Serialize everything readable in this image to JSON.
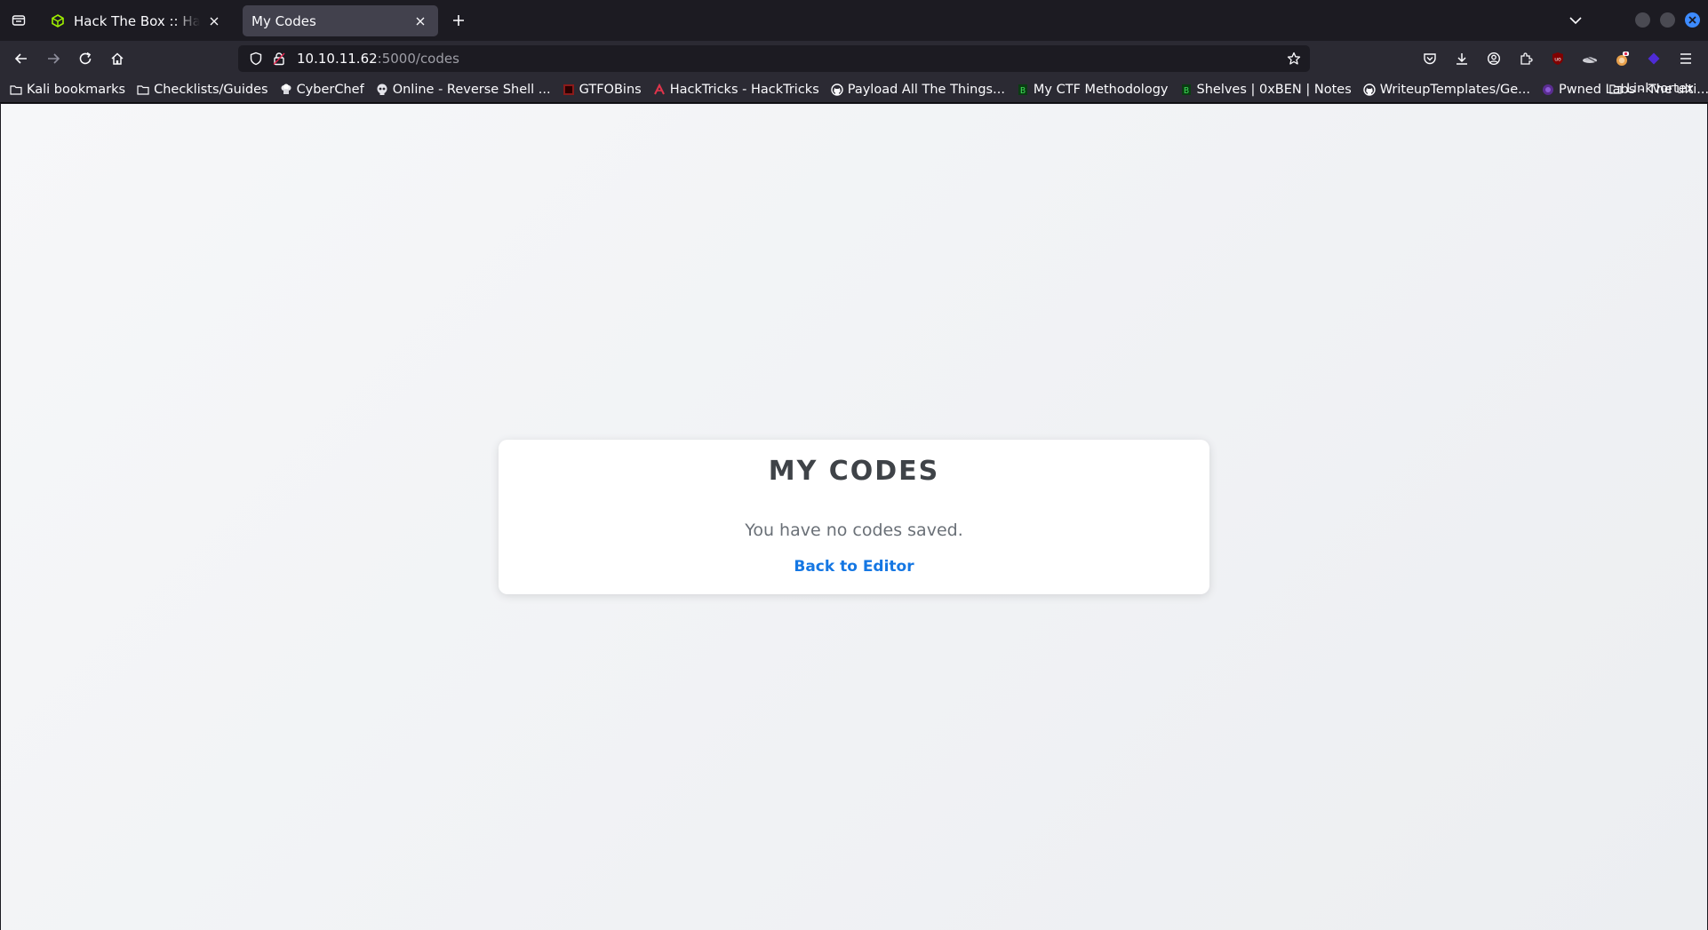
{
  "browser": {
    "tabs": [
      {
        "title": "Hack The Box :: Hack The Box",
        "favicon": "htb-cube-icon",
        "active": false
      },
      {
        "title": "My Codes",
        "favicon": "none",
        "active": true
      }
    ],
    "url": {
      "host": "10.10.11.62",
      "path": ":5000/codes"
    },
    "bookmarks": [
      {
        "label": "Kali bookmarks",
        "icon": "folder-icon"
      },
      {
        "label": "Checklists/Guides",
        "icon": "folder-icon"
      },
      {
        "label": "CyberChef",
        "icon": "chef-hat-icon"
      },
      {
        "label": "Online - Reverse Shell ...",
        "icon": "skull-icon"
      },
      {
        "label": "GTFOBins",
        "icon": "gtfobins-icon"
      },
      {
        "label": "HackTricks - HackTricks",
        "icon": "hacktricks-icon"
      },
      {
        "label": "Payload All The Things...",
        "icon": "github-icon"
      },
      {
        "label": "My CTF Methodology",
        "icon": "bookstack-icon"
      },
      {
        "label": "Shelves | 0xBEN | Notes",
        "icon": "bookstack-icon"
      },
      {
        "label": "WriteupTemplates/Ge...",
        "icon": "github-icon"
      },
      {
        "label": "Pwned Labs - The ulti...",
        "icon": "pwnedlabs-icon"
      }
    ],
    "bookmark_folder_right": {
      "label": "Linkvortex",
      "icon": "folder-icon"
    },
    "colors": {
      "accent": "#3d8bff",
      "tab_active_bg": "#42414d",
      "toolbar_bg": "#2b2a33"
    }
  },
  "page": {
    "heading": "MY CODES",
    "empty_message": "You have no codes saved.",
    "back_link": "Back to Editor",
    "colors": {
      "link": "#1577e3",
      "heading": "#3f4348",
      "text": "#6a7077"
    }
  }
}
